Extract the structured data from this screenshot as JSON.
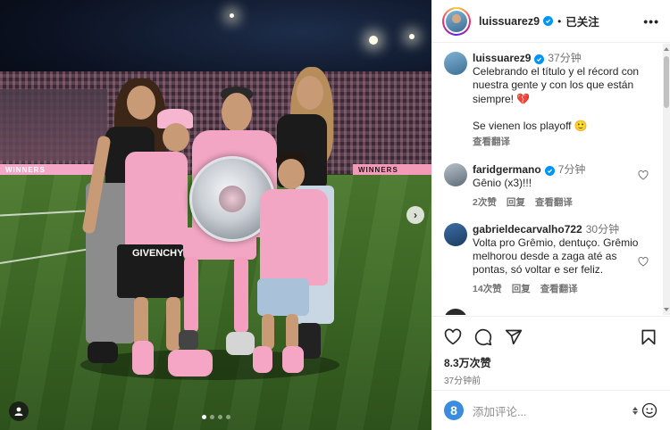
{
  "post": {
    "author": "luissuarez9",
    "follow_label": "已关注",
    "more_label": "•••",
    "likes": "8.3万次赞",
    "time": "37分钟前",
    "carousel": {
      "current": 1,
      "total": 4
    },
    "photo": {
      "board_left": "WINNERS",
      "board_right": "WINNERS",
      "next_label": "›"
    }
  },
  "caption": {
    "username": "luissuarez9",
    "time": "37分钟",
    "text_1": "Celebrando el título y el récord con nuestra gente y con los que están siempre! 💔",
    "text_2": "Se vienen los playoff 🙂",
    "translate": "查看翻译"
  },
  "comments": [
    {
      "username": "faridgermano",
      "time": "7分钟",
      "text": "Gênio (x3)!!!",
      "likes": "2次赞",
      "reply": "回复",
      "translate": "查看翻译"
    },
    {
      "username": "gabrieldecarvalho722",
      "time": "30分钟",
      "text": "Volta pro Grêmio, dentuço. Grêmio melhorou desde a zaga até as pontas, só voltar e ser feliz.",
      "likes": "14次赞",
      "reply": "回复",
      "translate": "查看翻译"
    }
  ],
  "add_comment": {
    "placeholder": "添加评论..."
  },
  "colors": {
    "verified": "#0095f6",
    "pink_jersey": "#f2a6c3",
    "heart_red": "#e0245e"
  }
}
